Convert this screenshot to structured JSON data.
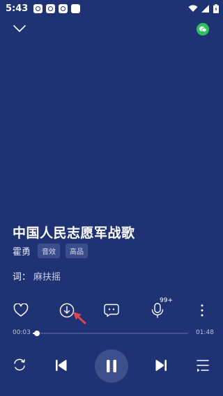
{
  "status_bar": {
    "time": "5:43",
    "icons": [
      "notification-icon",
      "notification-icon",
      "notification-icon",
      "notification-icon",
      "wifi-icon",
      "signal-icon",
      "battery-icon"
    ]
  },
  "player": {
    "song_title": "中国人民志愿军战歌",
    "artist": "霍勇",
    "tags": [
      "音效",
      "高品"
    ],
    "lyricist_label": "词：",
    "lyricist_name": "麻扶摇",
    "comment_count_badge": "99+",
    "progress": {
      "elapsed": "00:03",
      "total": "01:48",
      "fraction": 0.028
    }
  },
  "colors": {
    "background": "#1f3374",
    "accent_share": "#2ec05a",
    "pointer_arrow": "#e0454a"
  }
}
